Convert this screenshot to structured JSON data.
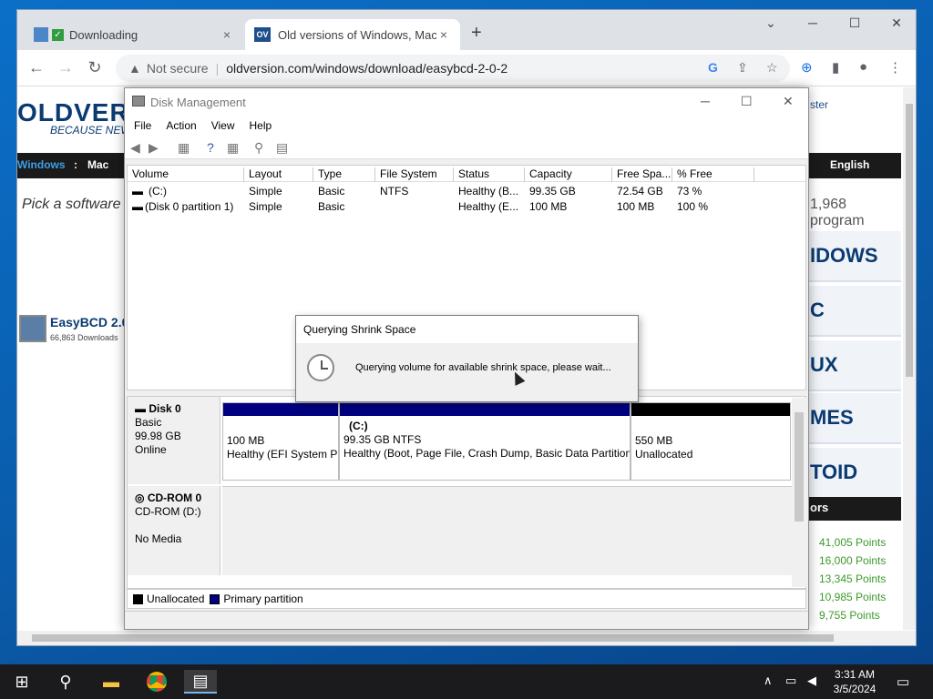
{
  "browser": {
    "tabs": [
      {
        "label": "Downloading",
        "close": "×"
      },
      {
        "label": "Old versions of Windows, Mac an",
        "close": "×"
      }
    ],
    "new_tab": "+",
    "not_secure": "Not secure",
    "url": "oldversion.com/windows/download/easybcd-2-0-2"
  },
  "site": {
    "logo": "OLDVER",
    "tagline": "BECAUSE NEWE",
    "nav": [
      "Windows",
      ":",
      "Mac",
      "English"
    ],
    "login_fragment": "ster",
    "pick": "Pick a software",
    "program_count": "1,968 program",
    "easy_title": "EasyBCD 2.0",
    "easy_downloads": "66,863 Downloads",
    "categories": [
      "IDOWS",
      "C",
      "UX",
      "MES",
      "TOID"
    ],
    "contributors": "ors",
    "points": [
      "41,005 Points",
      "16,000 Points",
      "13,345 Points",
      "10,985 Points",
      "9,755 Points"
    ]
  },
  "disk_management": {
    "title": "Disk Management",
    "menu": [
      "File",
      "Action",
      "View",
      "Help"
    ],
    "columns": [
      "Volume",
      "Layout",
      "Type",
      "File System",
      "Status",
      "Capacity",
      "Free Spa...",
      "% Free"
    ],
    "volumes": [
      [
        "(C:)",
        "Simple",
        "Basic",
        "NTFS",
        "Healthy (B...",
        "99.35 GB",
        "72.54 GB",
        "73 %"
      ],
      [
        "(Disk 0 partition 1)",
        "Simple",
        "Basic",
        "",
        "Healthy (E...",
        "100 MB",
        "100 MB",
        "100 %"
      ]
    ],
    "disk0": {
      "name": "Disk 0",
      "type": "Basic",
      "size": "99.98 GB",
      "state": "Online"
    },
    "partitions": [
      {
        "title": "",
        "size": "100 MB",
        "status": "Healthy (EFI System P",
        "color": "#000080"
      },
      {
        "title": "(C:)",
        "size": "99.35 GB NTFS",
        "status": "Healthy (Boot, Page File, Crash Dump, Basic Data Partition",
        "color": "#000080"
      },
      {
        "title": "",
        "size": "550 MB",
        "status": "Unallocated",
        "color": "#000000"
      }
    ],
    "cdrom": {
      "name": "CD-ROM 0",
      "drive": "CD-ROM (D:)",
      "media": "No Media"
    },
    "legend": [
      {
        "label": "Unallocated",
        "color": "#000000"
      },
      {
        "label": "Primary partition",
        "color": "#000080"
      }
    ]
  },
  "dialog": {
    "title": "Querying Shrink Space",
    "message": "Querying volume for available shrink space, please wait..."
  },
  "taskbar": {
    "time": "3:31 AM",
    "date": "3/5/2024"
  }
}
